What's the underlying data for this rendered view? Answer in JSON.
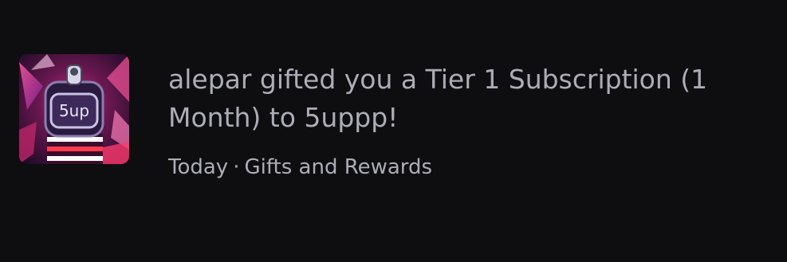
{
  "notification": {
    "avatar_icon": "channel-avatar-5up",
    "avatar_text": "5up",
    "message": "alepar gifted you a Tier 1 Subscription (1 Month) to 5uppp!",
    "meta": {
      "time": "Today",
      "separator": "·",
      "category": "Gifts and Rewards"
    }
  }
}
